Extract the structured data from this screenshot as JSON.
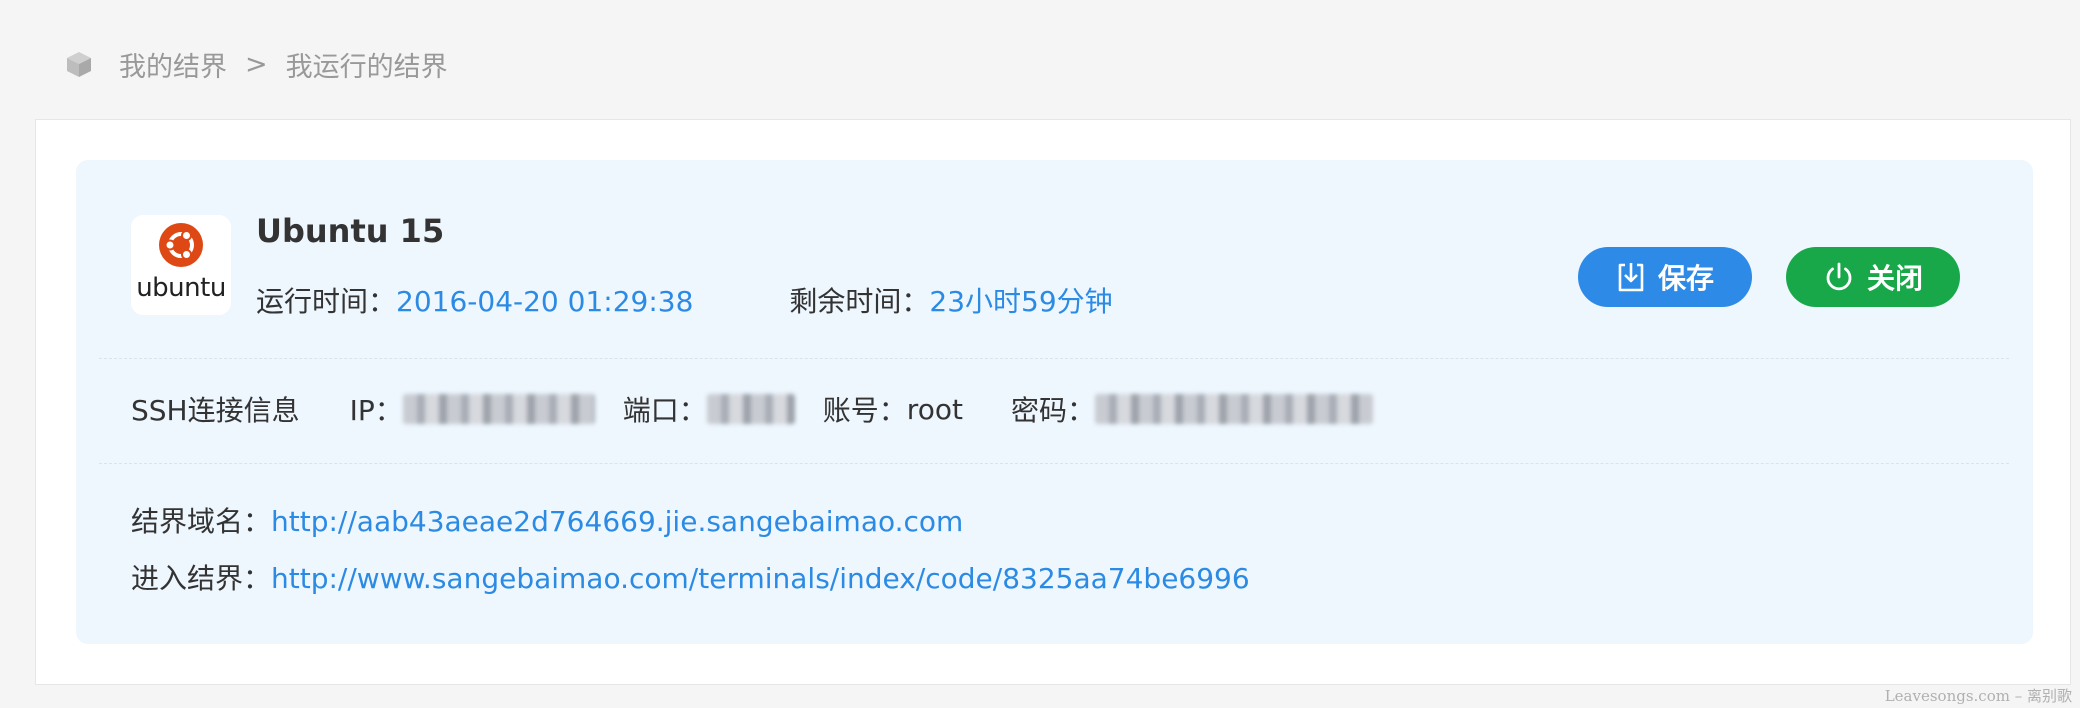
{
  "breadcrumb": {
    "icon": "cube-icon",
    "root": "我的结界",
    "separator": ">",
    "current": "我运行的结界"
  },
  "terminal": {
    "logo_text": "ubuntu",
    "logo_color": "#dd4814",
    "title": "Ubuntu 15",
    "run_time_label": "运行时间：",
    "run_time_value": "2016-04-20 01:29:38",
    "remaining_label": "剩余时间：",
    "remaining_value": "23小时59分钟"
  },
  "actions": {
    "save_label": "保存",
    "save_icon": "save-download-icon",
    "save_color": "#2d8ae6",
    "close_label": "关闭",
    "close_icon": "power-icon",
    "close_color": "#18a84a"
  },
  "ssh": {
    "title": "SSH连接信息",
    "ip_label": "IP：",
    "port_label": "端口：",
    "account_label": "账号：",
    "account_value": "root",
    "password_label": "密码："
  },
  "links": {
    "domain_label": "结界域名：",
    "domain_url": "http://aab43aeae2d764669.jie.sangebaimao.com",
    "enter_label": "进入结界：",
    "enter_url": "http://www.sangebaimao.com/terminals/index/code/8325aa74be6996"
  },
  "watermark": "Leavesongs.com – 离别歌",
  "colors": {
    "accent": "#2b8be4",
    "panel_bg": "#eef6fe",
    "page_bg": "#f5f5f5"
  }
}
